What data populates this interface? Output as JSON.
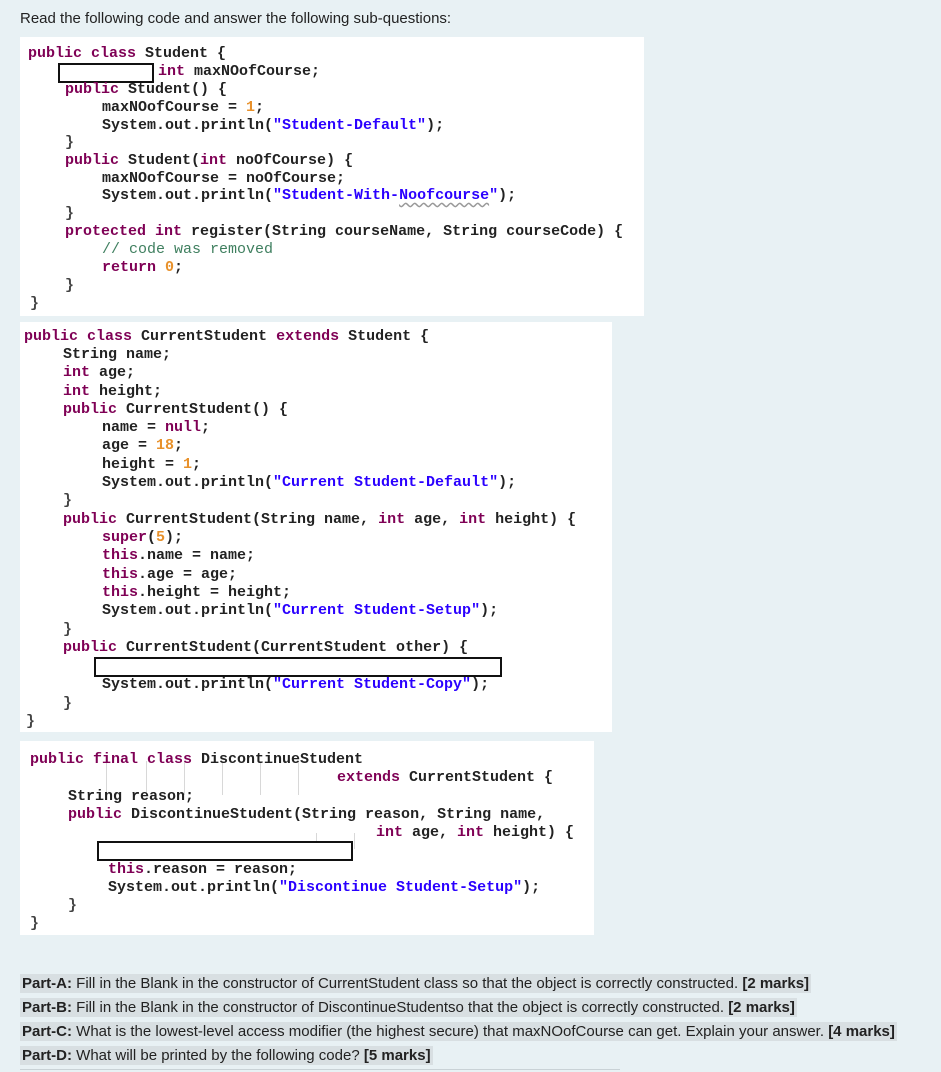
{
  "intro": "Read the following code and answer the following sub-questions:",
  "code1": [
    [
      "public class Student {"
    ],
    [
      "int maxNOofCourse;"
    ],
    [
      "public Student() {"
    ],
    [
      "maxNOofCourse = 1;"
    ],
    [
      "System.out.println(\"Student-Default\");"
    ],
    [
      "}"
    ],
    [
      "public Student(int noOfCourse) {"
    ],
    [
      "maxNOofCourse = noOfCourse;"
    ],
    [
      "System.out.println(\"Student-With-Noofcourse\");"
    ],
    [
      "}"
    ],
    [
      "protected int register(String courseName, String courseCode) {"
    ],
    [
      "// code was removed"
    ],
    [
      "return 0;"
    ],
    [
      "}"
    ],
    [
      "}"
    ]
  ],
  "code2": [
    [
      "public class CurrentStudent extends Student {"
    ],
    [
      "String name;"
    ],
    [
      "int age;"
    ],
    [
      "int height;"
    ],
    [
      "public CurrentStudent() {"
    ],
    [
      "name = null;"
    ],
    [
      "age = 18;"
    ],
    [
      "height = 1;"
    ],
    [
      "System.out.println(\"Current Student-Default\");"
    ],
    [
      "}"
    ],
    [
      "public CurrentStudent(String name, int age, int height) {"
    ],
    [
      "super(5);"
    ],
    [
      "this.name = name;"
    ],
    [
      "this.age = age;"
    ],
    [
      "this.height = height;"
    ],
    [
      "System.out.println(\"Current Student-Setup\");"
    ],
    [
      "}"
    ],
    [
      "public CurrentStudent(CurrentStudent other) {"
    ],
    [
      "System.out.println(\"Current Student-Copy\");"
    ],
    [
      "}"
    ],
    [
      "}"
    ]
  ],
  "code3": [
    [
      "public final class DiscontinueStudent"
    ],
    [
      "extends CurrentStudent {"
    ],
    [
      "String reason;"
    ],
    [
      "public DiscontinueStudent(String reason, String name,"
    ],
    [
      "int age, int height) {"
    ],
    [
      "this.reason = reason;"
    ],
    [
      "System.out.println(\"Discontinue Student-Setup\");"
    ],
    [
      "}"
    ],
    [
      "}"
    ]
  ],
  "parts": [
    {
      "label": "Part-A:",
      "text": " Fill in the Blank in the constructor of CurrentStudent class so that the object is correctly constructed.",
      "marks": "[2 marks]"
    },
    {
      "label": "Part-B:",
      "text": " Fill in the Blank in the constructor of DiscontinueStudentso that the object is correctly constructed.",
      "marks": "[2 marks]"
    },
    {
      "label": "Part-C:",
      "text": " What is the lowest-level access modifier (the highest secure) that maxNOofCourse can get.  Explain your answer.",
      "marks": "[4 marks]"
    },
    {
      "label": "Part-D:",
      "text": " What will be printed by the following code?",
      "marks": "[5 marks]"
    }
  ]
}
